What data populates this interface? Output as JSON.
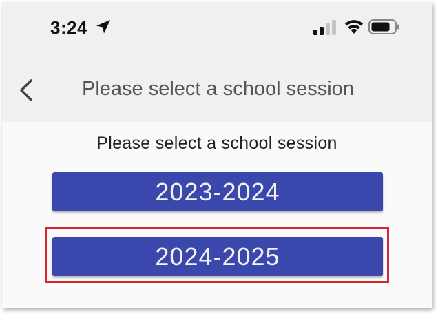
{
  "status_bar": {
    "time": "3:24",
    "icons": [
      "location-arrow-icon",
      "cellular-signal-icon",
      "wifi-icon",
      "battery-icon"
    ]
  },
  "nav": {
    "back_icon": "chevron-left-icon",
    "title": "Please select a school session"
  },
  "content": {
    "prompt": "Please select a school session",
    "sessions": [
      {
        "label": "2023-2024",
        "highlighted": false
      },
      {
        "label": "2024-2025",
        "highlighted": true
      }
    ]
  },
  "colors": {
    "button_bg": "#3a48ad",
    "button_text": "#f2f2f2",
    "highlight": "#d8262e",
    "nav_bg": "#f0f0f0"
  }
}
